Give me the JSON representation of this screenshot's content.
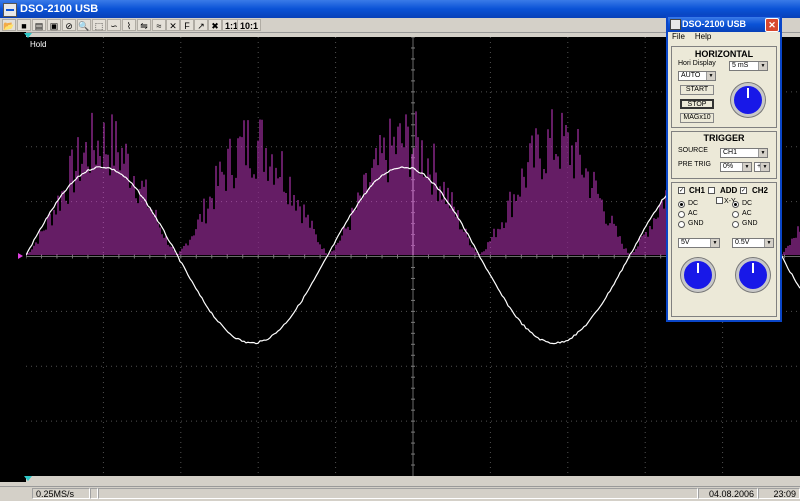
{
  "window": {
    "title": "DSO-2100 USB"
  },
  "toolbar": {
    "buttons": [
      "open-icon",
      "save-icon",
      "print-icon",
      "record-icon",
      "stop-icon",
      "zoom-icon",
      "select-icon",
      "curve-icon",
      "wave-icon",
      "measure-icon",
      "fft-icon",
      "x-icon",
      "ff-icon",
      "cursor-icon",
      "close-icon"
    ],
    "ratio_1": "1:1",
    "ratio_10": "10:1"
  },
  "scope": {
    "hold_label": "Hold"
  },
  "status": {
    "sample_rate": "0.25MS/s",
    "date": "04.08.2006",
    "time": "23:09"
  },
  "panel": {
    "title": "DSO-2100 USB",
    "menu": {
      "file": "File",
      "help": "Help"
    },
    "horizontal": {
      "header": "HORIZONTAL",
      "hori_display_label": "Hori Display",
      "timebase": "5 mS",
      "mode": "AUTO",
      "start": "START",
      "stop": "STOP",
      "mag": "MAGx10"
    },
    "trigger": {
      "header": "TRIGGER",
      "source_label": "SOURCE",
      "source": "CH1",
      "pretrig_label": "PRE TRIG",
      "pretrig": "0%",
      "slope": "+"
    },
    "channels": {
      "ch1": "CH1",
      "add": "ADD",
      "ch2": "CH2",
      "xy": "X-Y",
      "dc": "DC",
      "ac": "AC",
      "gnd": "GND",
      "ch1_volts": "5V",
      "ch2_volts": "0.5V"
    }
  },
  "colors": {
    "trace_ch1": "#e040e0",
    "trace_ch2": "#ffffff",
    "grid": "#505050",
    "background": "#000000"
  }
}
